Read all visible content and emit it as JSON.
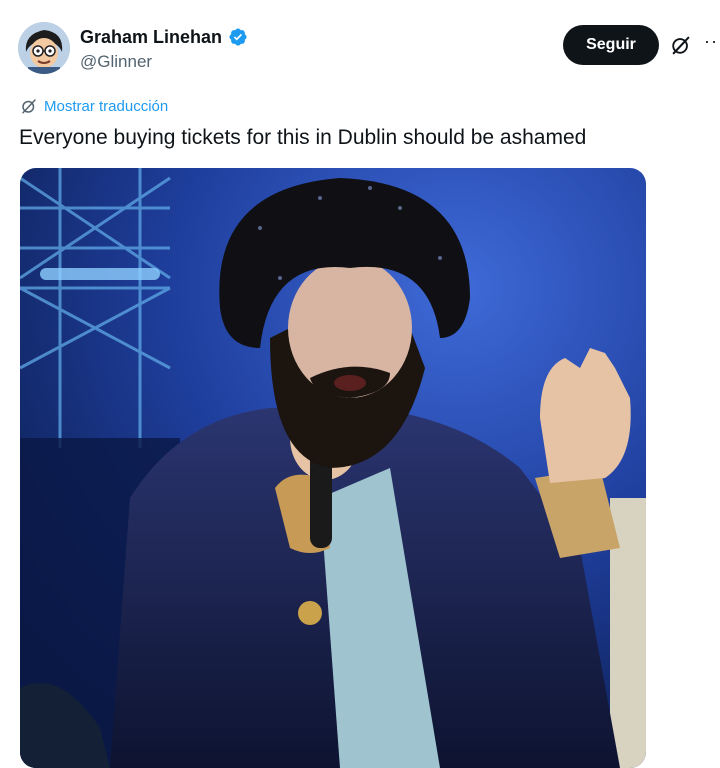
{
  "author": {
    "display_name": "Graham Linehan",
    "handle": "@Glinner",
    "verified": true
  },
  "actions": {
    "follow_label": "Seguir",
    "grok_icon": "grok-icon",
    "more_icon": "more-options-icon"
  },
  "tweet": {
    "translate_label": "Mostrar traducción",
    "text": "Everyone buying tickets for this in Dublin should be ashamed"
  },
  "colors": {
    "accent": "#1d9bf0",
    "text_primary": "#0f1419",
    "text_secondary": "#536471",
    "button_bg": "#0f1419"
  }
}
